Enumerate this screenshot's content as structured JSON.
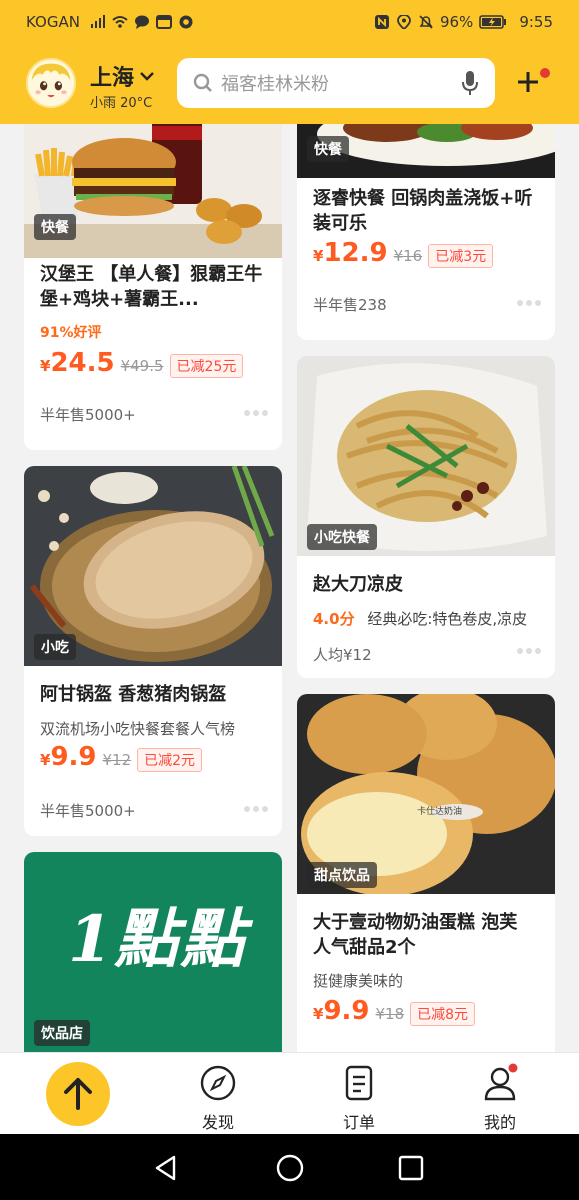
{
  "status_bar": {
    "carrier": "KOGAN",
    "battery": "96%",
    "time": "9:55"
  },
  "header": {
    "city": "上海",
    "weather": "小雨 20°C",
    "search_placeholder": "福客桂林米粉"
  },
  "feed": {
    "left": [
      {
        "tag": "快餐",
        "title": "汉堡王 【单人餐】狠霸王牛堡+鸡块+薯霸王...",
        "rating": "91%好评",
        "currency": "¥",
        "price": "24.5",
        "original_price": "¥49.5",
        "discount": "已减25元",
        "sales": "半年售5000+"
      },
      {
        "tag": "小吃",
        "title": "阿甘锅盔 香葱猪肉锅盔",
        "subtitle": "双流机场小吃快餐套餐人气榜",
        "currency": "¥",
        "price": "9.9",
        "original_price": "¥12",
        "discount": "已减2元",
        "sales": "半年售5000+"
      },
      {
        "tag": "饮品店",
        "logo_text": "1點點"
      }
    ],
    "right": [
      {
        "tag": "快餐",
        "title": "逐睿快餐 回锅肉盖浇饭+听装可乐",
        "currency": "¥",
        "price": "12.9",
        "original_price": "¥16",
        "discount": "已减3元",
        "sales": "半年售238"
      },
      {
        "tag": "小吃快餐",
        "title": "赵大刀凉皮",
        "score": "4.0分",
        "recommend": "经典必吃:特色卷皮,凉皮",
        "avg_price": "人均¥12"
      },
      {
        "tag": "甜点饮品",
        "title": "大于壹动物奶油蛋糕 泡芙 人气甜品2个",
        "subtitle": "挺健康美味的",
        "currency": "¥",
        "price": "9.9",
        "original_price": "¥18",
        "discount": "已减8元",
        "photo_label": "卡仕达奶油"
      }
    ]
  },
  "tabbar": {
    "items": [
      {
        "label": "发现"
      },
      {
        "label": "订单"
      },
      {
        "label": "我的"
      }
    ]
  },
  "colors": {
    "brand": "#fcc629",
    "price": "#ff5a1f",
    "accent_red": "#e53935"
  }
}
